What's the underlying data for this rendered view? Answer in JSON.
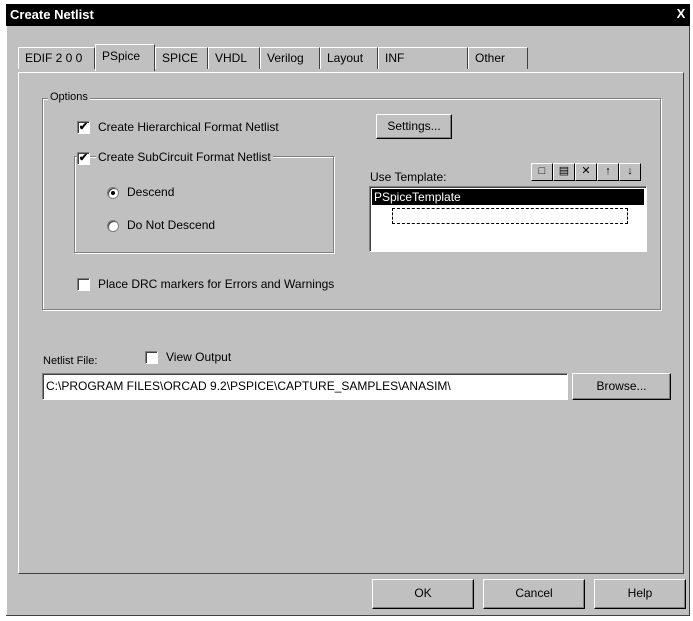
{
  "window": {
    "title": "Create Netlist",
    "close_glyph": "X"
  },
  "tabs": [
    {
      "label": "EDIF 2 0 0"
    },
    {
      "label": "PSpice"
    },
    {
      "label": "SPICE"
    },
    {
      "label": "VHDL"
    },
    {
      "label": "Verilog"
    },
    {
      "label": "Layout"
    },
    {
      "label": "INF"
    },
    {
      "label": "Other"
    }
  ],
  "options": {
    "group_label": "Options",
    "hierarchical": {
      "label": "Create Hierarchical Format Netlist",
      "checked": true
    },
    "settings_button": "Settings...",
    "subcircuit": {
      "label": "Create SubCircuit Format Netlist",
      "checked": true
    },
    "descend": {
      "label": "Descend",
      "selected": true
    },
    "no_descend": {
      "label": "Do Not Descend",
      "selected": false
    },
    "drc": {
      "label": "Place DRC markers for Errors and Warnings",
      "checked": false
    },
    "template": {
      "label": "Use Template:",
      "items": [
        "PSpiceTemplate"
      ],
      "toolbar": [
        "new-icon",
        "properties-icon",
        "delete-icon",
        "move-up-icon",
        "move-down-icon"
      ]
    }
  },
  "netlist": {
    "file_label": "Netlist File:",
    "view_output": {
      "label": "View Output",
      "checked": false
    },
    "path": "C:\\PROGRAM FILES\\ORCAD 9.2\\PSPICE\\CAPTURE_SAMPLES\\ANASIM\\",
    "browse_button": "Browse..."
  },
  "footer": {
    "ok": "OK",
    "cancel": "Cancel",
    "help": "Help"
  }
}
